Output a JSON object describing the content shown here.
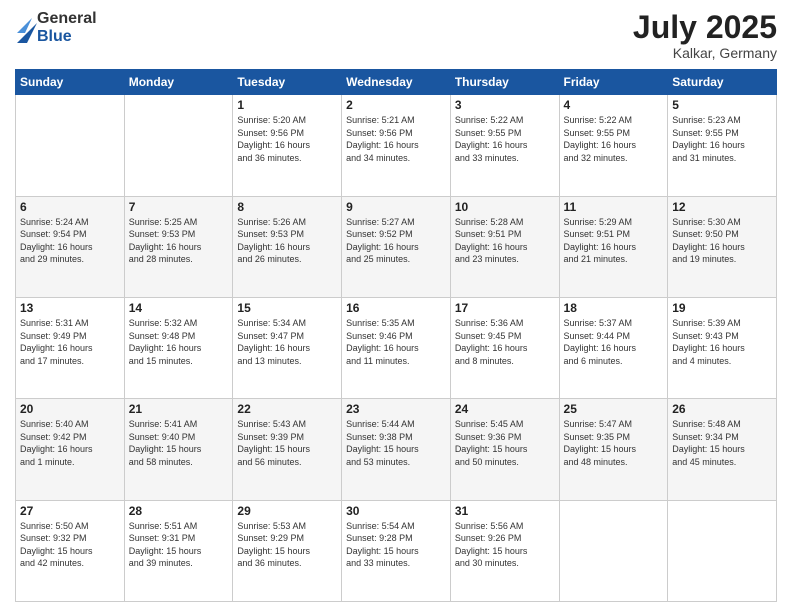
{
  "header": {
    "logo_general": "General",
    "logo_blue": "Blue",
    "month_year": "July 2025",
    "location": "Kalkar, Germany"
  },
  "weekdays": [
    "Sunday",
    "Monday",
    "Tuesday",
    "Wednesday",
    "Thursday",
    "Friday",
    "Saturday"
  ],
  "weeks": [
    [
      {
        "day": "",
        "info": ""
      },
      {
        "day": "",
        "info": ""
      },
      {
        "day": "1",
        "info": "Sunrise: 5:20 AM\nSunset: 9:56 PM\nDaylight: 16 hours\nand 36 minutes."
      },
      {
        "day": "2",
        "info": "Sunrise: 5:21 AM\nSunset: 9:56 PM\nDaylight: 16 hours\nand 34 minutes."
      },
      {
        "day": "3",
        "info": "Sunrise: 5:22 AM\nSunset: 9:55 PM\nDaylight: 16 hours\nand 33 minutes."
      },
      {
        "day": "4",
        "info": "Sunrise: 5:22 AM\nSunset: 9:55 PM\nDaylight: 16 hours\nand 32 minutes."
      },
      {
        "day": "5",
        "info": "Sunrise: 5:23 AM\nSunset: 9:55 PM\nDaylight: 16 hours\nand 31 minutes."
      }
    ],
    [
      {
        "day": "6",
        "info": "Sunrise: 5:24 AM\nSunset: 9:54 PM\nDaylight: 16 hours\nand 29 minutes."
      },
      {
        "day": "7",
        "info": "Sunrise: 5:25 AM\nSunset: 9:53 PM\nDaylight: 16 hours\nand 28 minutes."
      },
      {
        "day": "8",
        "info": "Sunrise: 5:26 AM\nSunset: 9:53 PM\nDaylight: 16 hours\nand 26 minutes."
      },
      {
        "day": "9",
        "info": "Sunrise: 5:27 AM\nSunset: 9:52 PM\nDaylight: 16 hours\nand 25 minutes."
      },
      {
        "day": "10",
        "info": "Sunrise: 5:28 AM\nSunset: 9:51 PM\nDaylight: 16 hours\nand 23 minutes."
      },
      {
        "day": "11",
        "info": "Sunrise: 5:29 AM\nSunset: 9:51 PM\nDaylight: 16 hours\nand 21 minutes."
      },
      {
        "day": "12",
        "info": "Sunrise: 5:30 AM\nSunset: 9:50 PM\nDaylight: 16 hours\nand 19 minutes."
      }
    ],
    [
      {
        "day": "13",
        "info": "Sunrise: 5:31 AM\nSunset: 9:49 PM\nDaylight: 16 hours\nand 17 minutes."
      },
      {
        "day": "14",
        "info": "Sunrise: 5:32 AM\nSunset: 9:48 PM\nDaylight: 16 hours\nand 15 minutes."
      },
      {
        "day": "15",
        "info": "Sunrise: 5:34 AM\nSunset: 9:47 PM\nDaylight: 16 hours\nand 13 minutes."
      },
      {
        "day": "16",
        "info": "Sunrise: 5:35 AM\nSunset: 9:46 PM\nDaylight: 16 hours\nand 11 minutes."
      },
      {
        "day": "17",
        "info": "Sunrise: 5:36 AM\nSunset: 9:45 PM\nDaylight: 16 hours\nand 8 minutes."
      },
      {
        "day": "18",
        "info": "Sunrise: 5:37 AM\nSunset: 9:44 PM\nDaylight: 16 hours\nand 6 minutes."
      },
      {
        "day": "19",
        "info": "Sunrise: 5:39 AM\nSunset: 9:43 PM\nDaylight: 16 hours\nand 4 minutes."
      }
    ],
    [
      {
        "day": "20",
        "info": "Sunrise: 5:40 AM\nSunset: 9:42 PM\nDaylight: 16 hours\nand 1 minute."
      },
      {
        "day": "21",
        "info": "Sunrise: 5:41 AM\nSunset: 9:40 PM\nDaylight: 15 hours\nand 58 minutes."
      },
      {
        "day": "22",
        "info": "Sunrise: 5:43 AM\nSunset: 9:39 PM\nDaylight: 15 hours\nand 56 minutes."
      },
      {
        "day": "23",
        "info": "Sunrise: 5:44 AM\nSunset: 9:38 PM\nDaylight: 15 hours\nand 53 minutes."
      },
      {
        "day": "24",
        "info": "Sunrise: 5:45 AM\nSunset: 9:36 PM\nDaylight: 15 hours\nand 50 minutes."
      },
      {
        "day": "25",
        "info": "Sunrise: 5:47 AM\nSunset: 9:35 PM\nDaylight: 15 hours\nand 48 minutes."
      },
      {
        "day": "26",
        "info": "Sunrise: 5:48 AM\nSunset: 9:34 PM\nDaylight: 15 hours\nand 45 minutes."
      }
    ],
    [
      {
        "day": "27",
        "info": "Sunrise: 5:50 AM\nSunset: 9:32 PM\nDaylight: 15 hours\nand 42 minutes."
      },
      {
        "day": "28",
        "info": "Sunrise: 5:51 AM\nSunset: 9:31 PM\nDaylight: 15 hours\nand 39 minutes."
      },
      {
        "day": "29",
        "info": "Sunrise: 5:53 AM\nSunset: 9:29 PM\nDaylight: 15 hours\nand 36 minutes."
      },
      {
        "day": "30",
        "info": "Sunrise: 5:54 AM\nSunset: 9:28 PM\nDaylight: 15 hours\nand 33 minutes."
      },
      {
        "day": "31",
        "info": "Sunrise: 5:56 AM\nSunset: 9:26 PM\nDaylight: 15 hours\nand 30 minutes."
      },
      {
        "day": "",
        "info": ""
      },
      {
        "day": "",
        "info": ""
      }
    ]
  ]
}
